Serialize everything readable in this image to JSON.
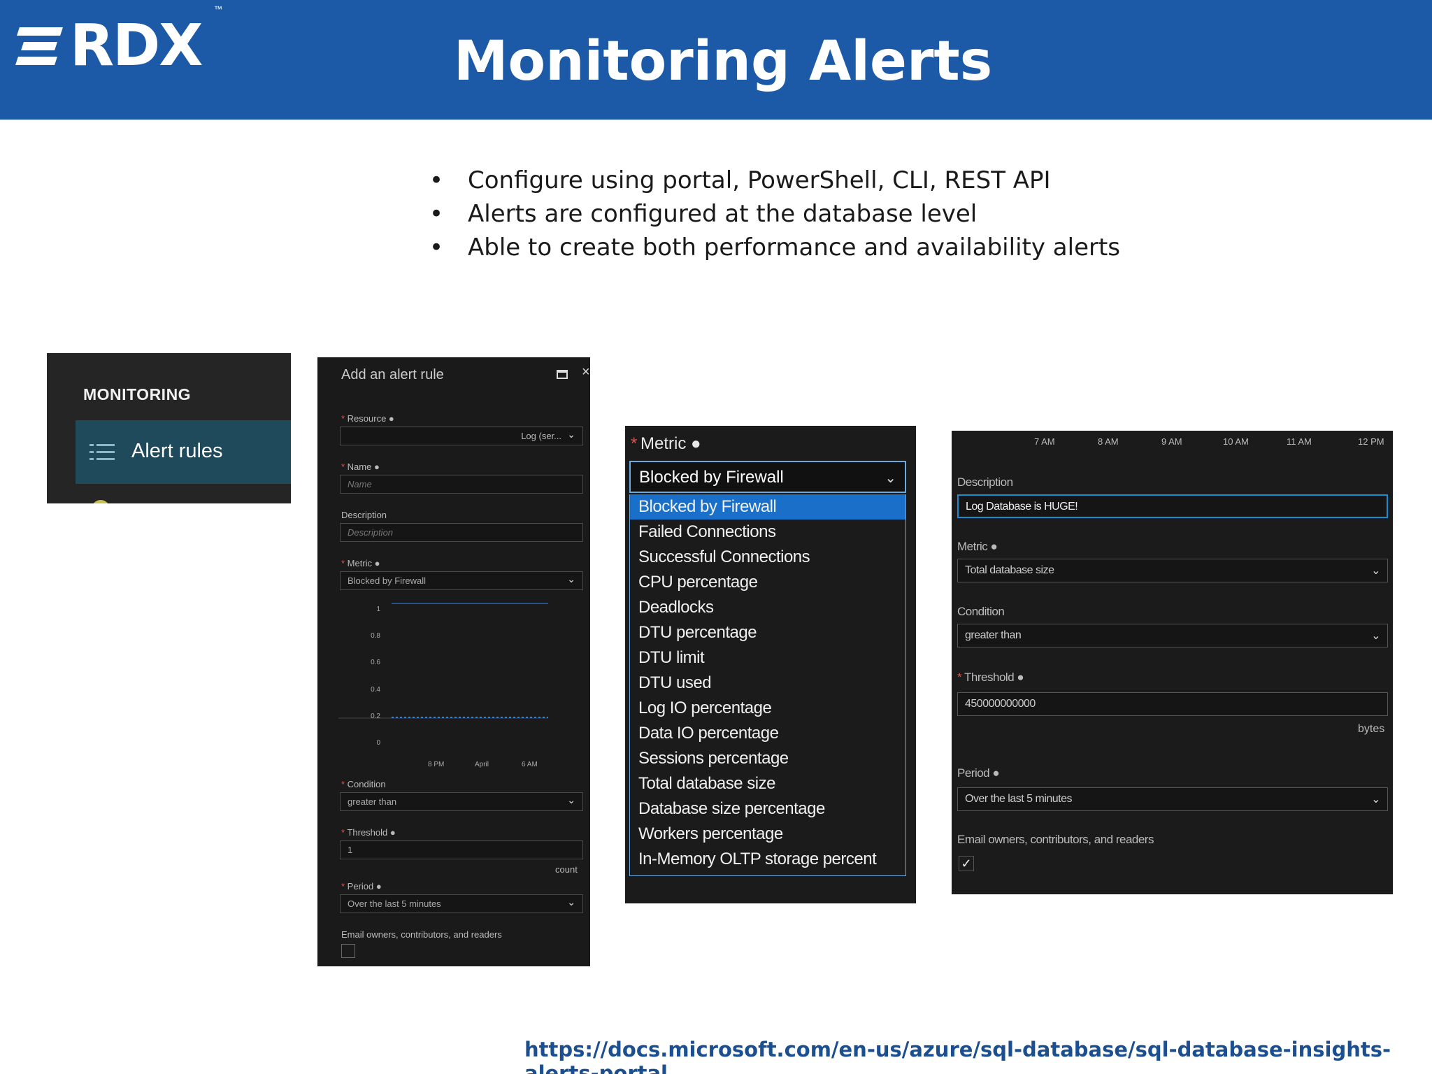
{
  "header": {
    "logo_text": "RDX",
    "logo_tm": "™",
    "title": "Monitoring Alerts"
  },
  "bullets": [
    "Configure using portal, PowerShell, CLI, REST API",
    "Alerts are configured at the database level",
    "Able to create both performance and availability alerts"
  ],
  "panel_monitoring": {
    "section_title": "MONITORING",
    "item_label": "Alert rules",
    "item_icon": "list-icon"
  },
  "panel_add_rule": {
    "title": "Add an alert rule",
    "resource_label": "Resource",
    "resource_value": "Log (ser...",
    "name_label": "Name",
    "name_placeholder": "Name",
    "description_label": "Description",
    "description_placeholder": "Description",
    "metric_label": "Metric",
    "metric_value": "Blocked by Firewall",
    "chart_y_ticks": [
      "1",
      "0.8",
      "0.6",
      "0.4",
      "0.2",
      "0"
    ],
    "chart_x_ticks": [
      "8 PM",
      "April",
      "6 AM"
    ],
    "condition_label": "Condition",
    "condition_value": "greater than",
    "threshold_label": "Threshold",
    "threshold_value": "1",
    "threshold_unit": "count",
    "period_label": "Period",
    "period_value": "Over the last 5 minutes",
    "email_label": "Email owners, contributors, and readers",
    "email_checked": false
  },
  "panel_metric_dropdown": {
    "label": "Metric",
    "selected": "Blocked by Firewall",
    "options": [
      "Blocked by Firewall",
      "Failed Connections",
      "Successful Connections",
      "CPU percentage",
      "Deadlocks",
      "DTU percentage",
      "DTU limit",
      "DTU used",
      "Log IO percentage",
      "Data IO percentage",
      "Sessions percentage",
      "Total database size",
      "Database size percentage",
      "Workers percentage",
      "In-Memory OLTP storage percent"
    ]
  },
  "panel_alert_config": {
    "time_ticks": [
      "7 AM",
      "8 AM",
      "9 AM",
      "10 AM",
      "11 AM",
      "12 PM"
    ],
    "description_label": "Description",
    "description_value": "Log Database is HUGE!",
    "metric_label": "Metric",
    "metric_value": "Total database size",
    "condition_label": "Condition",
    "condition_value": "greater than",
    "threshold_label": "Threshold",
    "threshold_value": "450000000000",
    "threshold_unit": "bytes",
    "period_label": "Period",
    "period_value": "Over the last 5 minutes",
    "email_label": "Email owners, contributors, and readers",
    "email_checked": true
  },
  "footer": {
    "link": "https://docs.microsoft.com/en-us/azure/sql-database/sql-database-insights-alerts-portal"
  },
  "colors": {
    "header_bg": "#1c5aa8",
    "panel_bg": "#1b1b1c",
    "selection": "#1a6fc9",
    "required": "#e05050",
    "link": "#1c4f8f"
  }
}
